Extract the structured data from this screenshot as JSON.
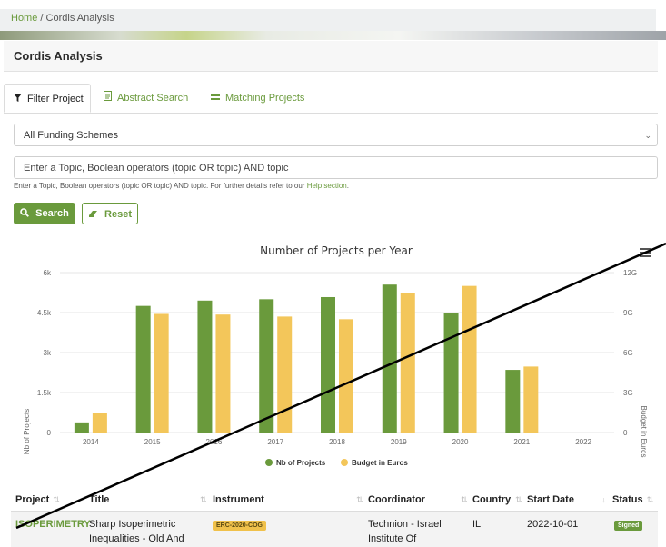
{
  "breadcrumb": {
    "home": "Home",
    "separator": "/",
    "current": "Cordis Analysis"
  },
  "page_title": "Cordis Analysis",
  "tabs": [
    {
      "label": "Filter Project",
      "icon": "filter-icon",
      "active": true
    },
    {
      "label": "Abstract Search",
      "icon": "document-icon",
      "active": false
    },
    {
      "label": "Matching Projects",
      "icon": "list-icon",
      "active": false
    }
  ],
  "filters": {
    "funding_scheme": "All Funding Schemes",
    "topic_placeholder": "Enter a Topic, Boolean operators (topic OR topic) AND topic",
    "help_text": "Enter a Topic, Boolean operators (topic OR topic) AND topic. For further details refer to our",
    "help_link": "Help section",
    "help_end": "."
  },
  "buttons": {
    "search": "Search",
    "reset": "Reset"
  },
  "chart_data": {
    "type": "bar",
    "title": "Number of Projects per Year",
    "categories": [
      "2014",
      "2015",
      "2016",
      "2017",
      "2018",
      "2019",
      "2020",
      "2021",
      "2022"
    ],
    "series": [
      {
        "name": "Nb of Projects",
        "axis": "left",
        "color": "#6a9a3c",
        "values": [
          380,
          4750,
          4950,
          5000,
          5080,
          5550,
          4500,
          2350,
          0
        ]
      },
      {
        "name": "Budget in Euros",
        "axis": "right",
        "color": "#f3c65a",
        "values": [
          1.5,
          8.9,
          8.85,
          8.7,
          8.5,
          10.5,
          11.0,
          4.95,
          0
        ]
      }
    ],
    "y_left": {
      "label": "Nb of Projects",
      "ticks": [
        "0",
        "1.5k",
        "3k",
        "4.5k",
        "6k"
      ],
      "range": [
        0,
        6000
      ]
    },
    "y_right": {
      "label": "Budget in Euros",
      "ticks": [
        "0",
        "3G",
        "6G",
        "9G",
        "12G"
      ],
      "range": [
        0,
        12
      ]
    },
    "legend": {
      "position": "bottom"
    },
    "grid": true
  },
  "table": {
    "headers": [
      "Project",
      "Title",
      "Instrument",
      "Coordinator",
      "Country",
      "Start Date",
      "Status"
    ],
    "rows": [
      {
        "project": "ISOPERIMETRY",
        "title_line1": "Sharp Isoperimetric",
        "title_line2": "Inequalities - Old And",
        "instrument": "ERC-2020-COG",
        "coordinator_line1": "Technion - Israel",
        "coordinator_line2": "Institute Of",
        "country": "IL",
        "start_date": "2022-10-01",
        "status": "Signed"
      }
    ]
  },
  "colors": {
    "accent": "#6a9a3c",
    "budget": "#f3c65a",
    "instrument_badge": "#f0c14b"
  }
}
